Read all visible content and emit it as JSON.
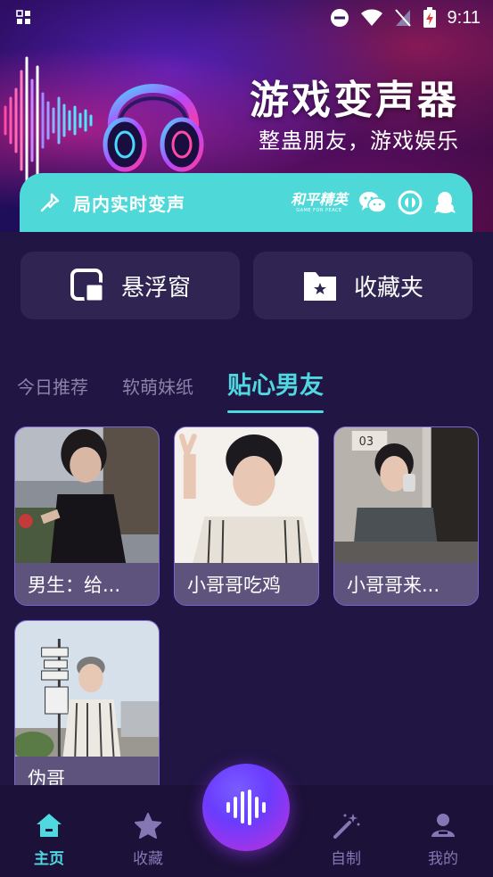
{
  "status_bar": {
    "time": "9:11"
  },
  "banner": {
    "title": "游戏变声器",
    "subtitle": "整蛊朋友，游戏娱乐"
  },
  "realtime": {
    "label": "局内实时变声",
    "game_logo_name": "和平精英",
    "game_logo_en": "GAME FOR PEACE"
  },
  "actions": {
    "float_window": "悬浮窗",
    "favorites": "收藏夹"
  },
  "tabs": [
    {
      "label": "今日推荐",
      "active": false
    },
    {
      "label": "软萌妹纸",
      "active": false
    },
    {
      "label": "贴心男友",
      "active": true
    }
  ],
  "cards": [
    {
      "title": "男生：给..."
    },
    {
      "title": "小哥哥吃鸡"
    },
    {
      "title": "小哥哥来..."
    },
    {
      "title": "伪哥"
    }
  ],
  "bottom_nav": [
    {
      "label": "主页",
      "icon": "home-icon",
      "active": true
    },
    {
      "label": "收藏",
      "icon": "star-icon",
      "active": false
    },
    {
      "label": "自制",
      "icon": "magic-wand-icon",
      "active": false
    },
    {
      "label": "我的",
      "icon": "user-icon",
      "active": false
    }
  ],
  "colors": {
    "accent": "#4fd8e0",
    "background": "#211544",
    "card_border": "#7a63d4"
  }
}
